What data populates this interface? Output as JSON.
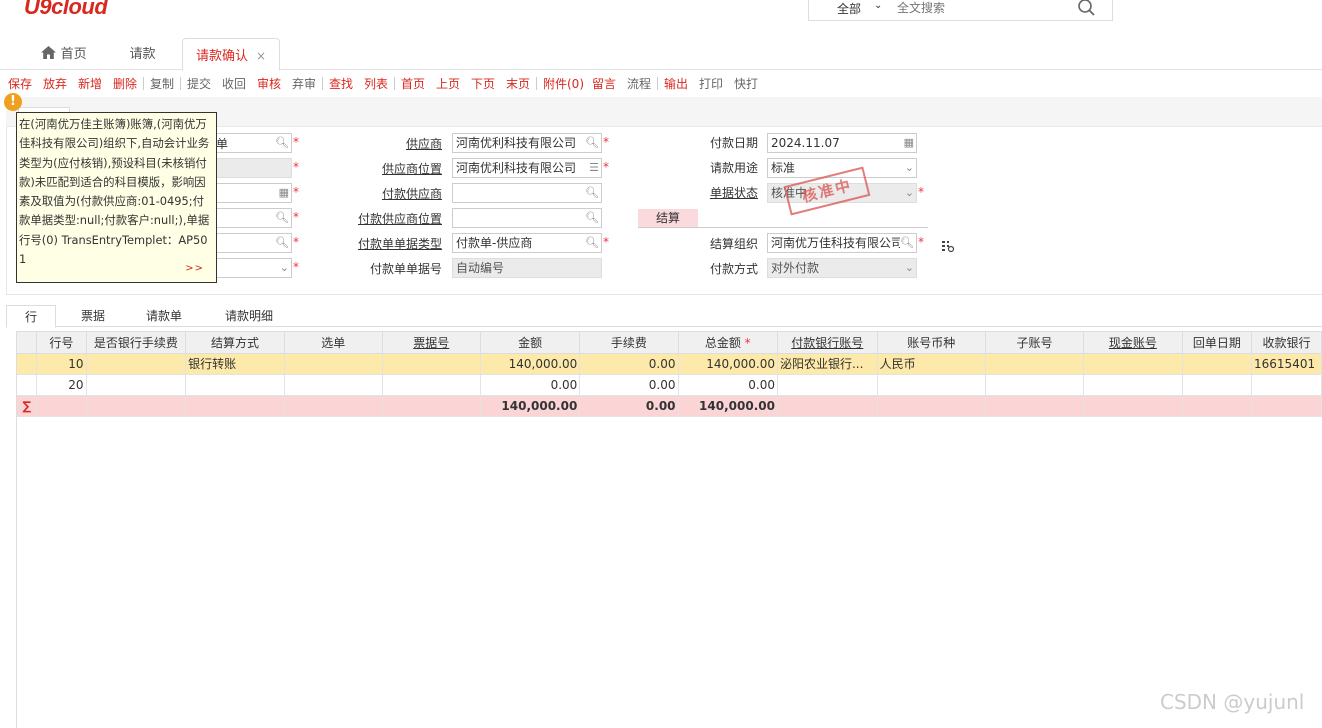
{
  "header": {
    "logo": "U9cloud",
    "search_scope": "全部",
    "search_placeholder": "全文搜索"
  },
  "tabs": {
    "home": "首页",
    "request": "请款",
    "confirm": "请款确认",
    "close_glyph": "×"
  },
  "toolbar": {
    "items": [
      "保存",
      "放弃",
      "新增",
      "删除",
      "复制",
      "提交",
      "收回",
      "审核",
      "弃审",
      "查找",
      "列表",
      "首页",
      "上页",
      "下页",
      "末页",
      "附件(0)",
      "留言",
      "流程",
      "输出",
      "打印",
      "快打"
    ]
  },
  "tooltip": {
    "text": "在(河南优万佳主账簿)账簿,(河南优万佳科技有限公司)组织下,自动会计业务类型为(应付核销),预设科目(未核销付款)未匹配到适合的科目模版，影响因素及取值为(付款供应商:01-0495;付款单据类型:null;付款客户:null;),单据行号(0) TransEntryTemplet：AP501",
    "more": ">>"
  },
  "form": {
    "left_partial": "单",
    "supplier_label": "供应商",
    "supplier_value": "河南优利科技有限公司",
    "supplier_location_label": "供应商位置",
    "supplier_location_value": "河南优利科技有限公司",
    "pay_supplier_label": "付款供应商",
    "pay_supplier_value": "",
    "pay_supplier_location_label": "付款供应商位置",
    "pay_supplier_location_value": "",
    "pay_doc_type_label": "付款单单据类型",
    "pay_doc_type_value": "付款单-供应商",
    "pay_doc_no_label": "付款单单据号",
    "pay_doc_no_value": "自动编号",
    "pay_date_label": "付款日期",
    "pay_date_value": "2024.11.07",
    "purpose_label": "请款用途",
    "purpose_value": "标准",
    "status_label": "单据状态",
    "status_value": "核准中",
    "seal_text": "核准中",
    "settle_tab": "结算",
    "settle_org_label": "结算组织",
    "settle_org_value": "河南优万佳科技有限公司",
    "pay_method_label": "付款方式",
    "pay_method_value": "对外付款"
  },
  "detail_tabs": [
    "行",
    "票据",
    "请款单",
    "请款明细"
  ],
  "grid": {
    "columns": [
      "行号",
      "是否银行手续费",
      "结算方式",
      "选单",
      "票据号",
      "金额",
      "手续费",
      "总金额",
      "付款银行账号",
      "账号币种",
      "子账号",
      "现金账号",
      "回单日期",
      "收款银行"
    ],
    "rows": [
      {
        "line": "10",
        "bank_fee": "",
        "settle": "银行转账",
        "select": "",
        "bill_no": "",
        "amount": "140,000.00",
        "fee": "0.00",
        "total": "140,000.00",
        "bank_acct": "泌阳农业银行...",
        "currency": "人民币",
        "sub_acct": "",
        "cash_acct": "",
        "receipt_date": "",
        "recv_bank": "16615401"
      },
      {
        "line": "20",
        "bank_fee": "",
        "settle": "",
        "select": "",
        "bill_no": "",
        "amount": "0.00",
        "fee": "0.00",
        "total": "0.00",
        "bank_acct": "",
        "currency": "",
        "sub_acct": "",
        "cash_acct": "",
        "receipt_date": "",
        "recv_bank": ""
      }
    ],
    "sum": {
      "symbol": "∑",
      "amount": "140,000.00",
      "fee": "0.00",
      "total": "140,000.00"
    }
  },
  "watermark": "CSDN @yujunl",
  "colors": {
    "brand": "#d9281f",
    "selected_row": "#fde9a9",
    "sum_row": "#fbd4d6"
  }
}
